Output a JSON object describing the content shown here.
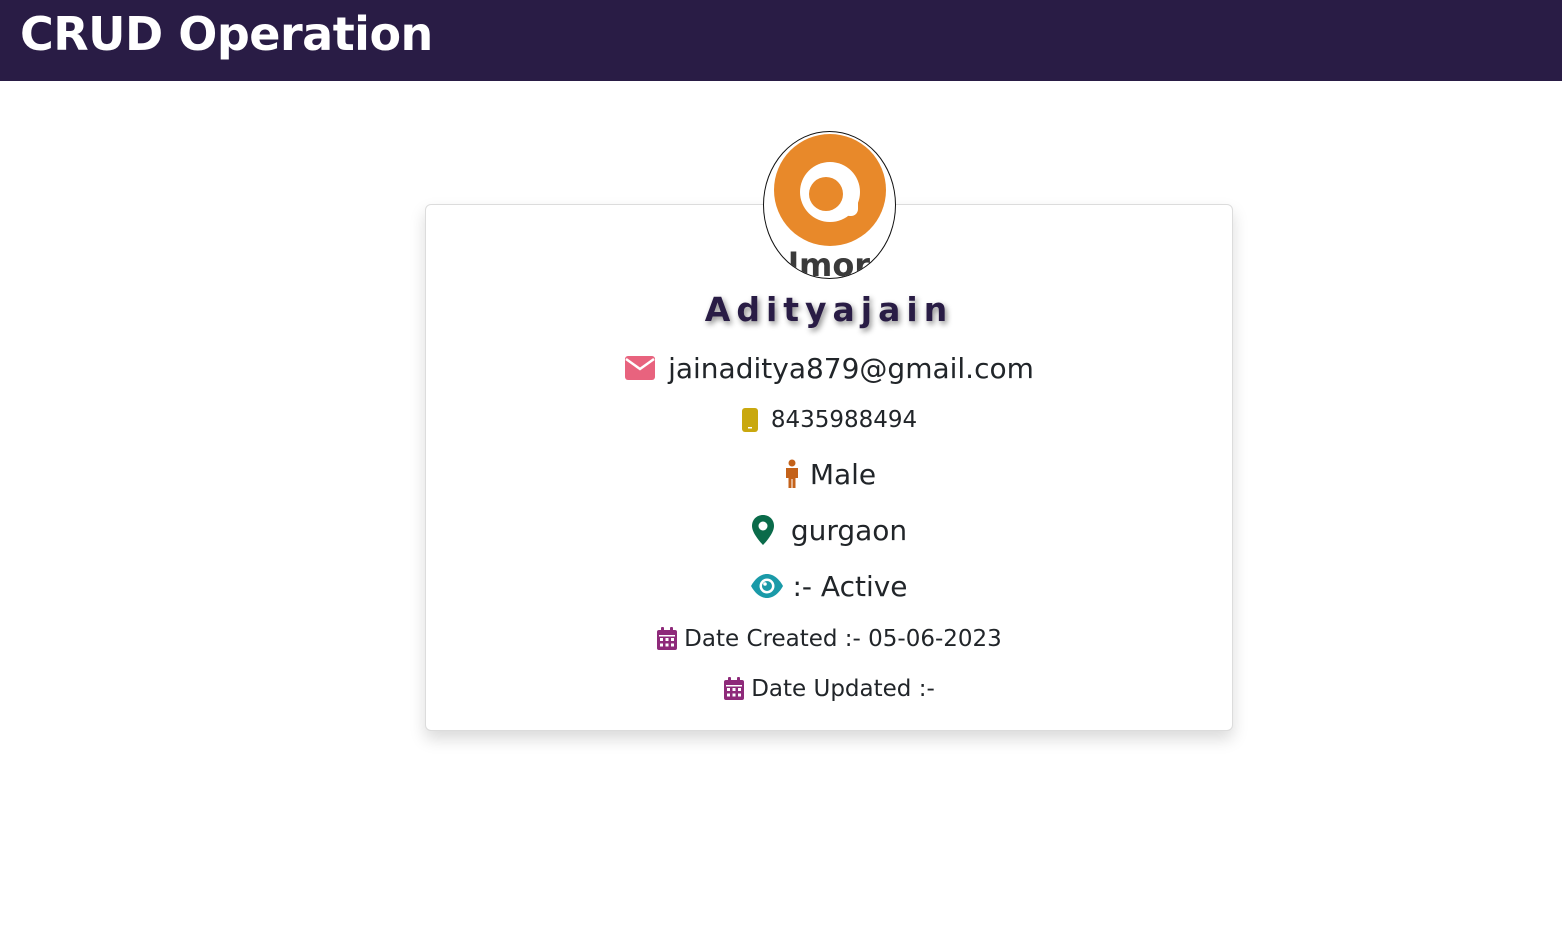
{
  "header": {
    "title": "CRUD Operation"
  },
  "profile": {
    "logo_text": "lmor",
    "name": "Adityajain",
    "email": "jainaditya879@gmail.com",
    "phone": "8435988494",
    "gender": "Male",
    "location": "gurgaon",
    "status": ":- Active",
    "date_created": "Date Created :- 05-06-2023",
    "date_updated": "Date Updated :-"
  },
  "icons": {
    "email": "envelope-icon",
    "phone": "mobile-phone-icon",
    "gender": "person-icon",
    "location": "map-pin-icon",
    "status": "eye-icon",
    "dates": "calendar-icon"
  },
  "colors": {
    "navbar": "#291c45",
    "logo_orange": "#e8892a",
    "email_icon": "#e8637e",
    "phone_icon": "#c9a80e",
    "gender_icon": "#c4621a",
    "location_icon": "#0a6b4a",
    "status_icon": "#1a9aa8",
    "calendar_icon": "#8e2a7a"
  }
}
